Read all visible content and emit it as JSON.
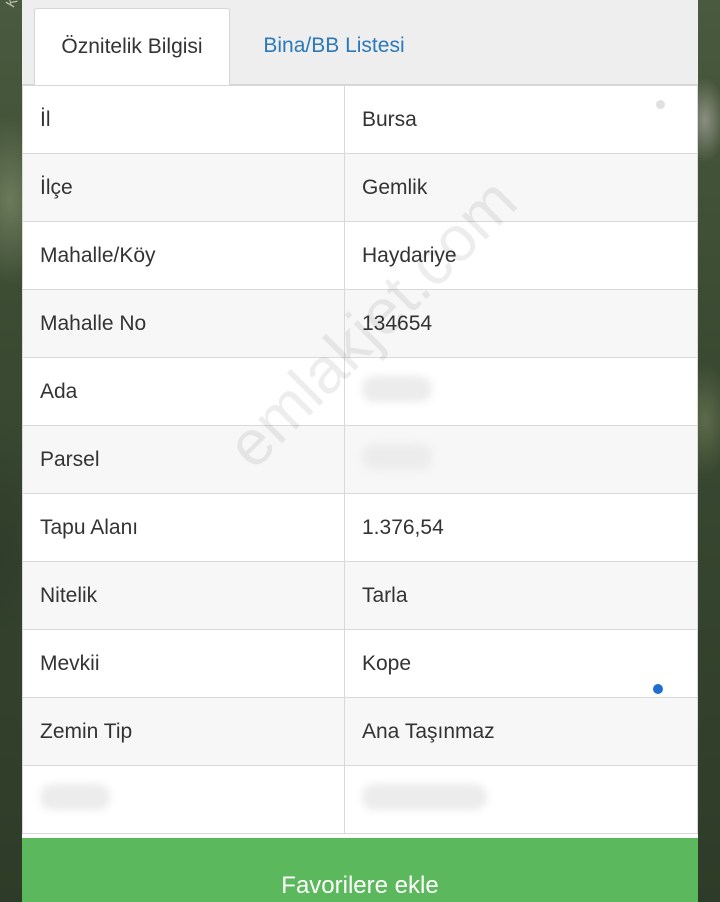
{
  "map": {
    "corner_label": "Kö"
  },
  "tabs": [
    {
      "label": "Öznitelik Bilgisi",
      "active": true
    },
    {
      "label": "Bina/BB Listesi",
      "active": false
    }
  ],
  "attributes": [
    {
      "key": "İl",
      "value": "Bursa"
    },
    {
      "key": "İlçe",
      "value": "Gemlik"
    },
    {
      "key": "Mahalle/Köy",
      "value": "Haydariye"
    },
    {
      "key": "Mahalle No",
      "value": "134654"
    },
    {
      "key": "Ada",
      "value": ""
    },
    {
      "key": "Parsel",
      "value": ""
    },
    {
      "key": "Tapu Alanı",
      "value": "1.376,54"
    },
    {
      "key": "Nitelik",
      "value": "Tarla"
    },
    {
      "key": "Mevkii",
      "value": "Kope"
    },
    {
      "key": "Zemin Tip",
      "value": "Ana Taşınmaz"
    },
    {
      "key": "",
      "value": ""
    }
  ],
  "footer": {
    "favorite_label": "Favorilere ekle"
  },
  "watermark": "emlakjet.com",
  "colors": {
    "accent_green": "#5cb85c",
    "tab_link": "#2b79b8",
    "dot_blue": "#1f6fd1"
  }
}
